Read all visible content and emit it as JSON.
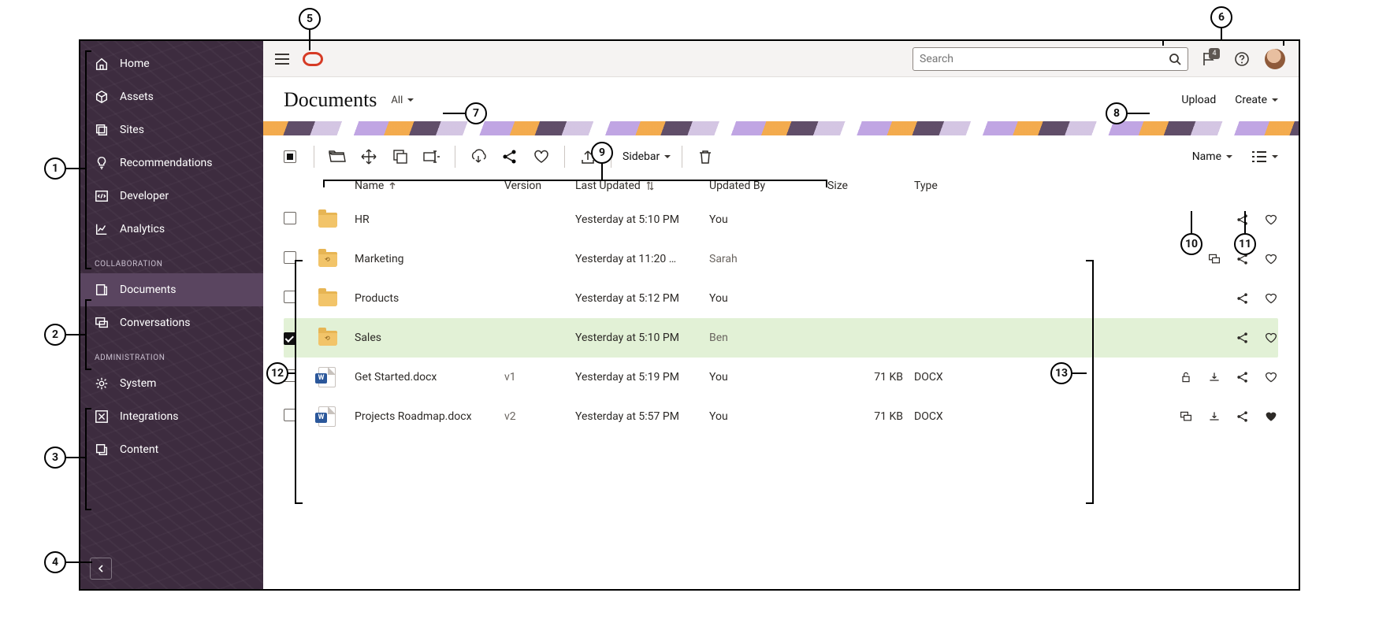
{
  "sidebar": {
    "main": [
      {
        "icon": "home",
        "label": "Home"
      },
      {
        "icon": "cube",
        "label": "Assets"
      },
      {
        "icon": "layers",
        "label": "Sites"
      },
      {
        "icon": "bulb",
        "label": "Recommendations"
      },
      {
        "icon": "code",
        "label": "Developer"
      },
      {
        "icon": "chart",
        "label": "Analytics"
      }
    ],
    "section_collab": "COLLABORATION",
    "collab": [
      {
        "icon": "doc",
        "label": "Documents",
        "active": true
      },
      {
        "icon": "chat",
        "label": "Conversations"
      }
    ],
    "section_admin": "ADMINISTRATION",
    "admin": [
      {
        "icon": "gear",
        "label": "System"
      },
      {
        "icon": "plug",
        "label": "Integrations"
      },
      {
        "icon": "stack",
        "label": "Content"
      }
    ]
  },
  "topbar": {
    "search_placeholder": "Search",
    "notif_count": "4"
  },
  "page": {
    "title": "Documents",
    "filter_label": "All",
    "upload": "Upload",
    "create": "Create"
  },
  "toolbar": {
    "sidebar_dropdown": "Sidebar",
    "sort_label": "Name"
  },
  "columns": {
    "name": "Name",
    "version": "Version",
    "updated": "Last Updated",
    "by": "Updated By",
    "size": "Size",
    "type": "Type"
  },
  "rows": [
    {
      "sel": false,
      "kind": "folder",
      "shared": false,
      "name": "HR",
      "version": "",
      "updated": "Yesterday at 5:10 PM",
      "by": "You",
      "size": "",
      "type": "",
      "acts": [
        "share",
        "fav"
      ]
    },
    {
      "sel": false,
      "kind": "folder",
      "shared": true,
      "name": "Marketing",
      "version": "",
      "updated": "Yesterday at 11:20 …",
      "by": "Sarah",
      "size": "",
      "type": "",
      "acts": [
        "conv",
        "share",
        "fav"
      ]
    },
    {
      "sel": false,
      "kind": "folder",
      "shared": false,
      "name": "Products",
      "version": "",
      "updated": "Yesterday at 5:12 PM",
      "by": "You",
      "size": "",
      "type": "",
      "acts": [
        "share",
        "fav"
      ]
    },
    {
      "sel": true,
      "kind": "folder",
      "shared": true,
      "name": "Sales",
      "version": "",
      "updated": "Yesterday at 5:10 PM",
      "by": "Ben",
      "size": "",
      "type": "",
      "acts": [
        "share",
        "fav"
      ]
    },
    {
      "sel": false,
      "kind": "docx",
      "name": "Get Started.docx",
      "version": "v1",
      "updated": "Yesterday at 5:19 PM",
      "by": "You",
      "size": "71 KB",
      "type": "DOCX",
      "acts": [
        "lock",
        "download",
        "share",
        "fav"
      ]
    },
    {
      "sel": false,
      "kind": "docx",
      "name": "Projects Roadmap.docx",
      "version": "v2",
      "updated": "Yesterday at 5:57 PM",
      "by": "You",
      "size": "71 KB",
      "type": "DOCX",
      "acts": [
        "conv",
        "download",
        "share",
        "fav-on"
      ]
    }
  ]
}
